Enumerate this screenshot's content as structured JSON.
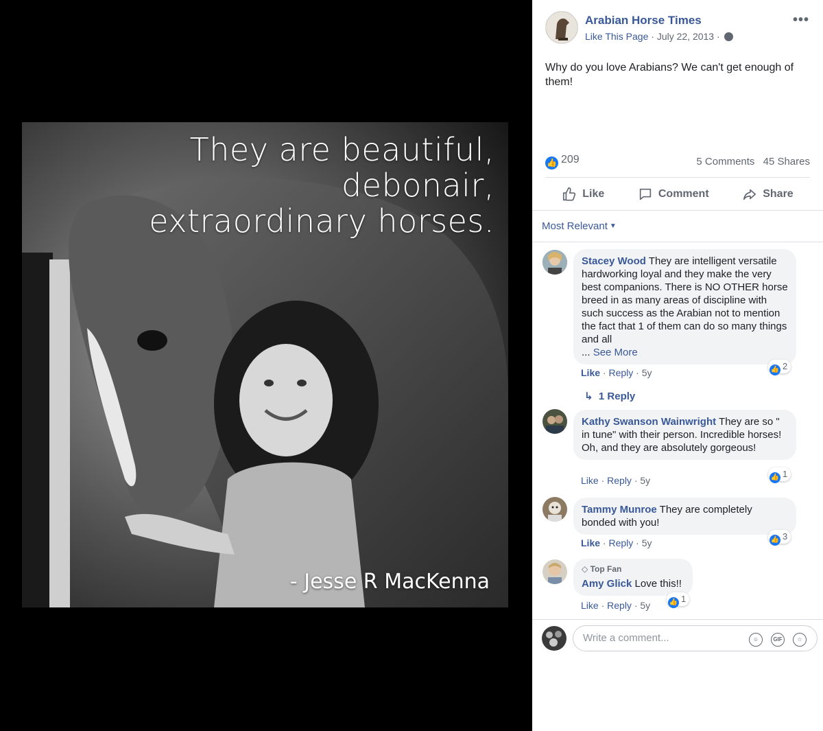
{
  "photo": {
    "quote_line1": "They are beautiful, debonair,",
    "quote_line2": "extraordinary horses.",
    "attribution": "- Jesse R MacKenna"
  },
  "post": {
    "page_name": "Arabian Horse Times",
    "like_page": "Like This Page",
    "date": "July 22, 2013",
    "separator": "·",
    "more_icon": "•••",
    "text": "Why do you love Arabians? We can't get enough of them!",
    "reaction_count": "209",
    "comments_count": "5 Comments",
    "shares_count": "45 Shares"
  },
  "actions": {
    "like": "Like",
    "comment": "Comment",
    "share": "Share"
  },
  "sort": {
    "label": "Most Relevant"
  },
  "comments": [
    {
      "author": "Stacey Wood",
      "text": "They are intelligent versatile hardworking loyal and they make the very best companions. There is NO OTHER horse breed in as many areas of discipline with such success as the Arabian not to mention the fact that 1 of them can do so many things and all",
      "ellipsis": "...",
      "see_more": "See More",
      "like": "Like",
      "reply": "Reply",
      "time": "5y",
      "reactions": "2",
      "replies": "1 Reply"
    },
    {
      "author": "Kathy Swanson Wainwright",
      "text": "They are so \" in tune\" with their person. Incredible horses! Oh, and they are absolutely gorgeous!",
      "like": "Like",
      "reply": "Reply",
      "time": "5y",
      "reactions": "1"
    },
    {
      "author": "Tammy Munroe",
      "text": "They are completely bonded with you!",
      "like": "Like",
      "reply": "Reply",
      "time": "5y",
      "reactions": "3"
    },
    {
      "badge": "Top Fan",
      "author": "Amy Glick",
      "text": "Love this!!",
      "like": "Like",
      "reply": "Reply",
      "time": "5y",
      "reactions": "1"
    }
  ],
  "composer": {
    "placeholder": "Write a comment...",
    "gif_label": "GIF"
  },
  "colors": {
    "link_blue": "#385898",
    "like_blue": "#1877f2",
    "bubble_gray": "#f2f3f5"
  },
  "icons": [
    "globe-icon",
    "like-icon",
    "comment-icon",
    "share-icon",
    "reply-arrow-icon",
    "emoji-icon",
    "gif-icon",
    "sticker-icon",
    "diamond-icon"
  ]
}
